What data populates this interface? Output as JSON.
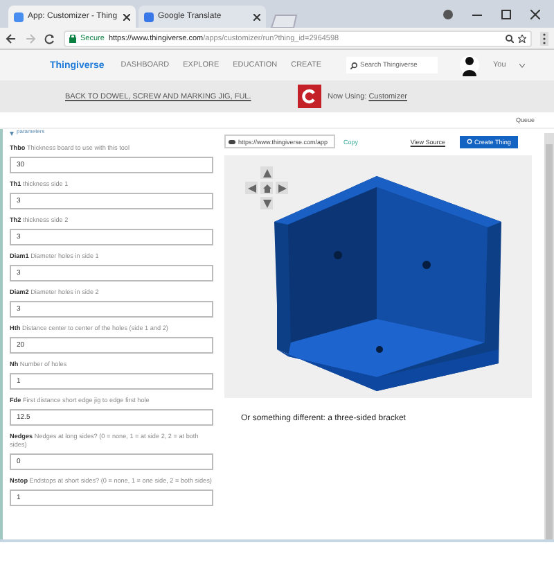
{
  "browser": {
    "tabs": [
      {
        "label": "App: Customizer - Thing",
        "selected": true
      },
      {
        "label": "Google Translate",
        "selected": false
      }
    ],
    "secure_label": "Secure",
    "url_host": "https://www.thingiverse.com",
    "url_path": "/apps/customizer/run?thing_id=2964598"
  },
  "site_nav": {
    "logo": "Thingiverse",
    "items": [
      "DASHBOARD",
      "EXPLORE",
      "EDUCATION",
      "CREATE"
    ],
    "search": {
      "placeholder": "Search Thingiverse"
    },
    "user": "You"
  },
  "banner": {
    "back_link": "BACK TO DOWEL, SCREW AND MARKING JIG, FUL.",
    "now_using": "Now Using:",
    "app_link": "Customizer"
  },
  "queue": "Queue",
  "section_toggle": "parameters",
  "parameters": [
    {
      "name": "Thbo",
      "hint": "Thickness board to use with this tool",
      "value": "30"
    },
    {
      "name": "Th1",
      "hint": "thickness side 1",
      "value": "3"
    },
    {
      "name": "Th2",
      "hint": "thickness side 2",
      "value": "3"
    },
    {
      "name": "Diam1",
      "hint": "Diameter holes in side 1",
      "value": "3"
    },
    {
      "name": "Diam2",
      "hint": "Diameter holes in side 2",
      "value": "3"
    },
    {
      "name": "Hth",
      "hint": "Distance center to center of the holes (side 1 and 2)",
      "value": "20"
    },
    {
      "name": "Nh",
      "hint": "Number of holes",
      "value": "1"
    },
    {
      "name": "Fde",
      "hint": "First distance short edge jig to edge first hole",
      "value": "12.5"
    },
    {
      "name": "Nedges",
      "hint": "Nedges at long sides? (0 = none, 1 = at side 2, 2 = at both sides)",
      "value": "0"
    },
    {
      "name": "Nstop",
      "hint": "Endstops at short sides? (0 = none, 1 = one side, 2 = both sides)",
      "value": "1"
    }
  ],
  "viewer": {
    "share_url": "https://www.thingiverse.com/app",
    "copy": "Copy",
    "view_source": "View Source",
    "create": "Create Thing"
  },
  "caption": "Or something different: a three-sided bracket"
}
